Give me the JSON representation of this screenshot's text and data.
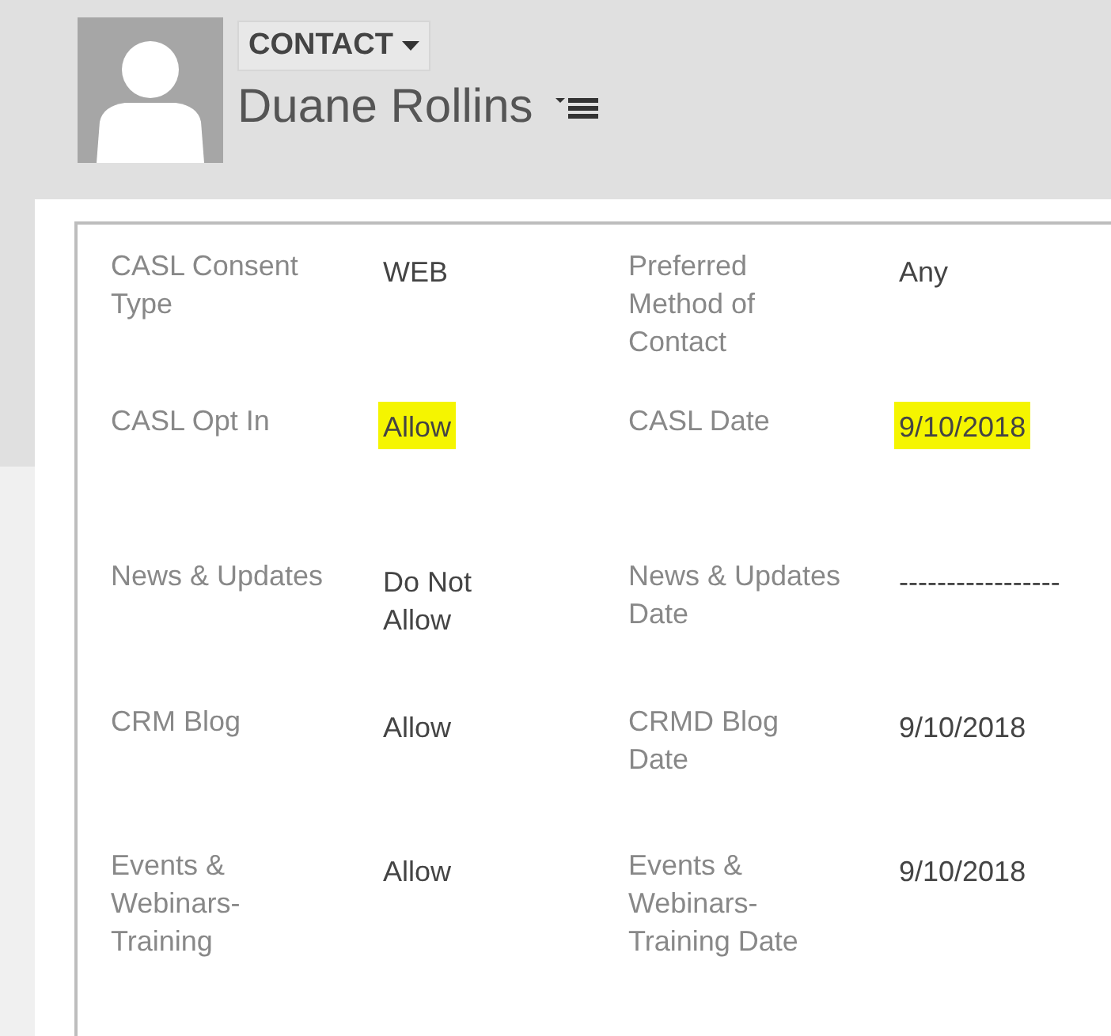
{
  "header": {
    "entity": "CONTACT",
    "name": "Duane Rollins"
  },
  "form": {
    "rows": [
      [
        {
          "label": "CASL Consent Type",
          "value": "WEB",
          "highlighted": false
        },
        {
          "label": "Preferred Method of Contact",
          "value": "Any",
          "highlighted": false
        }
      ],
      [
        {
          "label": "CASL Opt In",
          "value": "Allow",
          "highlighted": true
        },
        {
          "label": "CASL Date",
          "value": "9/10/2018",
          "highlighted": true
        }
      ],
      [
        {
          "label": "News & Updates",
          "value": "Do Not Allow",
          "highlighted": false
        },
        {
          "label": "News & Updates Date",
          "value": "-----------------",
          "highlighted": false
        }
      ],
      [
        {
          "label": "CRM Blog",
          "value": "Allow",
          "highlighted": false
        },
        {
          "label": "CRMD Blog Date",
          "value": "9/10/2018",
          "highlighted": false
        }
      ],
      [
        {
          "label": "Events & Webinars-Training",
          "value": "Allow",
          "highlighted": false
        },
        {
          "label": "Events & Webinars-Training Date",
          "value": "9/10/2018",
          "highlighted": false
        }
      ]
    ]
  }
}
